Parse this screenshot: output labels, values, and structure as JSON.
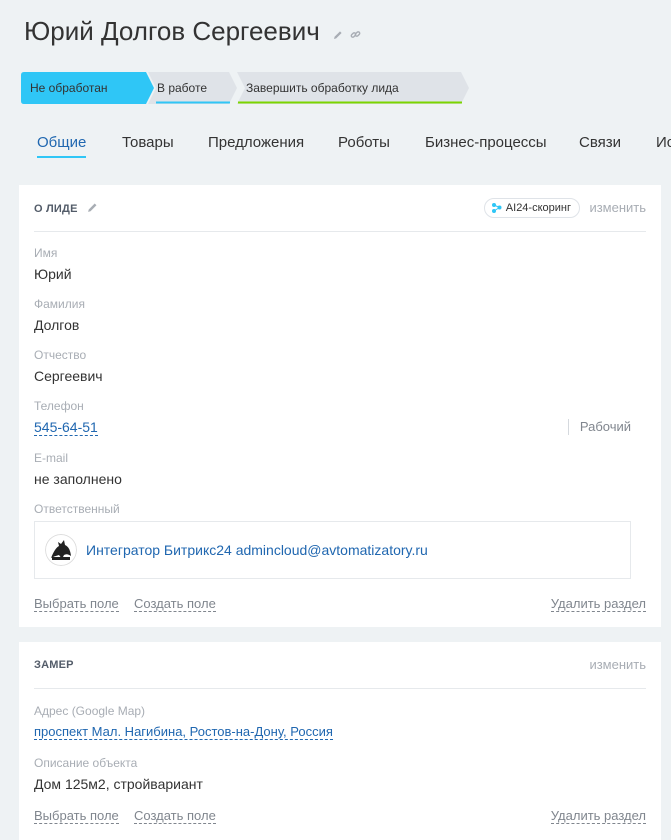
{
  "header": {
    "title": "Юрий Долгов  Сергеевич"
  },
  "stages": [
    {
      "label": "Не обработан",
      "color": "#2fc6f6",
      "active": true
    },
    {
      "label": "В работе",
      "color": "#dfe3e8",
      "underline": "#2fc6f6"
    },
    {
      "label": "Завершить обработку лида",
      "color": "#dfe3e8",
      "underline": "#7bd500"
    }
  ],
  "tabs": [
    {
      "label": "Общие",
      "active": true
    },
    {
      "label": "Товары"
    },
    {
      "label": "Предложения"
    },
    {
      "label": "Роботы"
    },
    {
      "label": "Бизнес-процессы"
    },
    {
      "label": "Связи"
    },
    {
      "label": "Ис"
    }
  ],
  "lead_card": {
    "title": "О ЛИДЕ",
    "ai_badge": "AI24-скоринг",
    "change_label": "изменить",
    "fields": {
      "name_label": "Имя",
      "name_value": "Юрий",
      "lastname_label": "Фамилия",
      "lastname_value": "Долгов",
      "patronymic_label": "Отчество",
      "patronymic_value": "Сергеевич",
      "phone_label": "Телефон",
      "phone_value": "545-64-51",
      "phone_type": "Рабочий",
      "email_label": "E-mail",
      "email_value": "не заполнено",
      "responsible_label": "Ответственный",
      "responsible_name": "Интегратор Битрикс24 admincloud@avtomatizatory.ru"
    },
    "footer": {
      "choose_field": "Выбрать поле",
      "create_field": "Создать поле",
      "delete_section": "Удалить раздел"
    }
  },
  "measure_card": {
    "title": "ЗАМЕР",
    "change_label": "изменить",
    "fields": {
      "address_label": "Адрес (Google Map)",
      "address_value": "проспект Мал. Нагибина, Ростов-на-Дону, Россия",
      "description_label": "Описание объекта",
      "description_value": "Дом 125м2, стройвариант"
    },
    "footer": {
      "choose_field": "Выбрать поле",
      "create_field": "Создать поле",
      "delete_section": "Удалить раздел"
    }
  },
  "colors": {
    "accent": "#2fc6f6",
    "link": "#2067b0",
    "muted": "#a8adb4",
    "done": "#7bd500"
  }
}
